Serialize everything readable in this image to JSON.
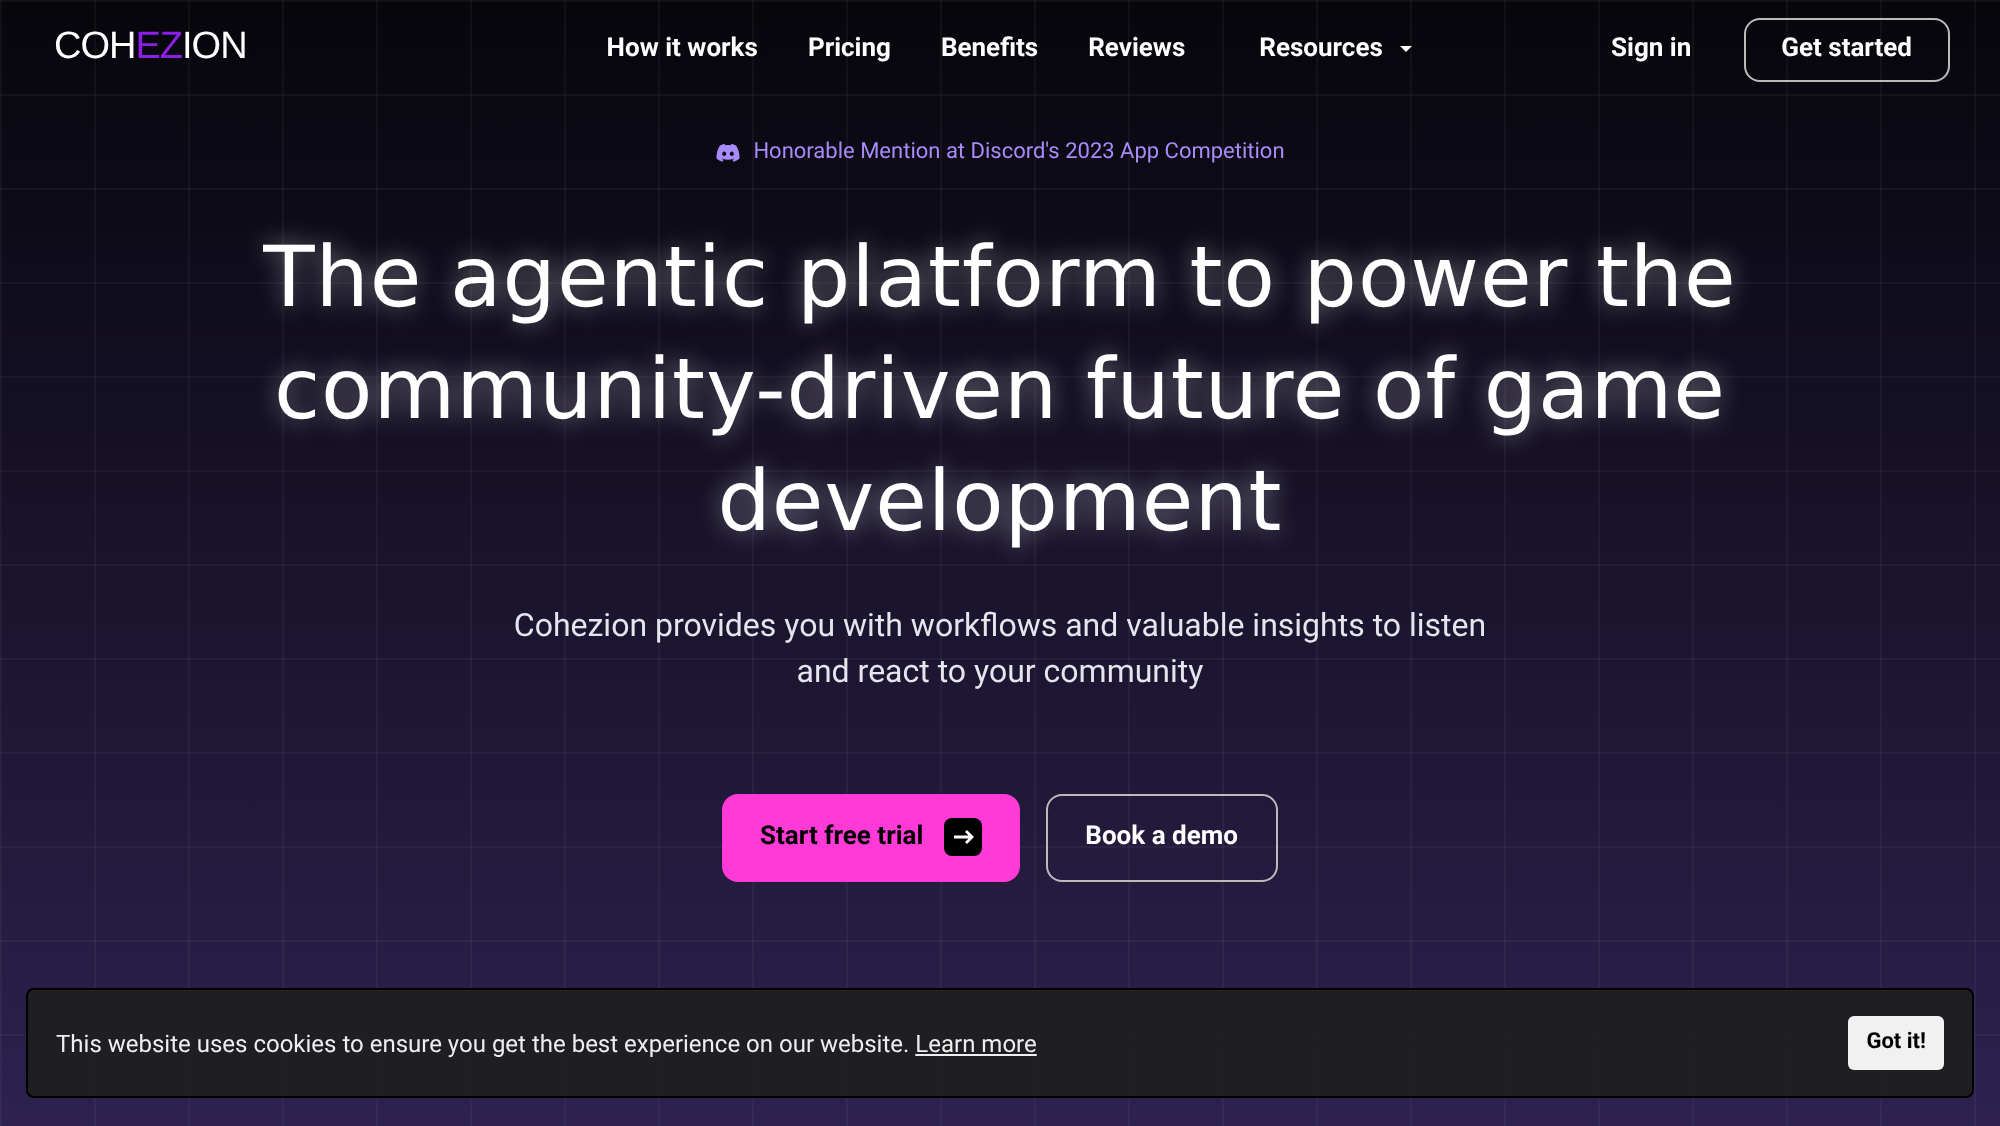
{
  "logo": {
    "parts": [
      {
        "text": "COH",
        "accent": false
      },
      {
        "text": "EZ",
        "accent": true
      },
      {
        "text": "ION",
        "accent": false
      }
    ]
  },
  "nav": {
    "links": [
      {
        "label": "How it works",
        "dropdown": false
      },
      {
        "label": "Pricing",
        "dropdown": false
      },
      {
        "label": "Benefits",
        "dropdown": false
      },
      {
        "label": "Reviews",
        "dropdown": false
      },
      {
        "label": "Resources",
        "dropdown": true
      }
    ],
    "sign_in": "Sign in",
    "cta": "Get started"
  },
  "badge": "Honorable Mention at Discord's 2023 App Competition",
  "hero": {
    "title_lines": [
      "The agentic platform to power the",
      "community-driven future of game",
      "development"
    ],
    "subtitle": "Cohezion provides you with workflows and valuable insights to listen and react to your community",
    "primary": "Start free trial",
    "secondary": "Book a demo"
  },
  "cookie": {
    "text": "This website uses cookies to ensure you get the best experience on our website.",
    "link": "Learn more",
    "button": "Got it!"
  }
}
